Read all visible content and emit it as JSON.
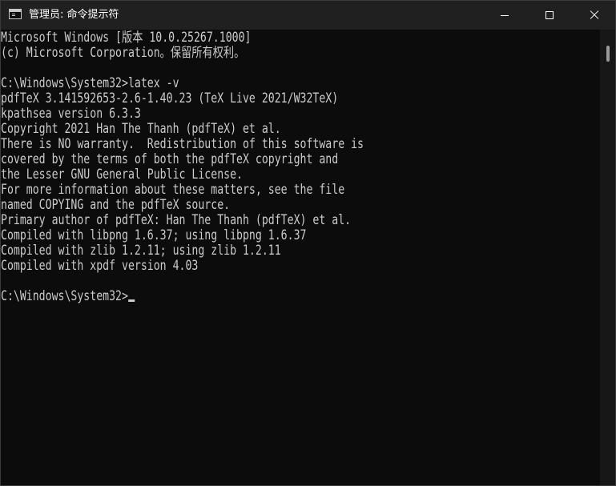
{
  "window": {
    "title": "管理员: 命令提示符",
    "app_icon": "cmd-icon",
    "controls": [
      "minimize-icon",
      "maximize-icon",
      "close-icon"
    ]
  },
  "console": {
    "lines": [
      "Microsoft Windows [版本 10.0.25267.1000]",
      "(c) Microsoft Corporation。保留所有权利。",
      "",
      "C:\\Windows\\System32>latex -v",
      "pdfTeX 3.141592653-2.6-1.40.23 (TeX Live 2021/W32TeX)",
      "kpathsea version 6.3.3",
      "Copyright 2021 Han The Thanh (pdfTeX) et al.",
      "There is NO warranty.  Redistribution of this software is",
      "covered by the terms of both the pdfTeX copyright and",
      "the Lesser GNU General Public License.",
      "For more information about these matters, see the file",
      "named COPYING and the pdfTeX source.",
      "Primary author of pdfTeX: Han The Thanh (pdfTeX) et al.",
      "Compiled with libpng 1.6.37; using libpng 1.6.37",
      "Compiled with zlib 1.2.11; using zlib 1.2.11",
      "Compiled with xpdf version 4.03",
      ""
    ],
    "prompt": "C:\\Windows\\System32>"
  },
  "colors": {
    "background": "#0c0c0c",
    "titlebar": "#202020",
    "text": "#cccccc"
  }
}
